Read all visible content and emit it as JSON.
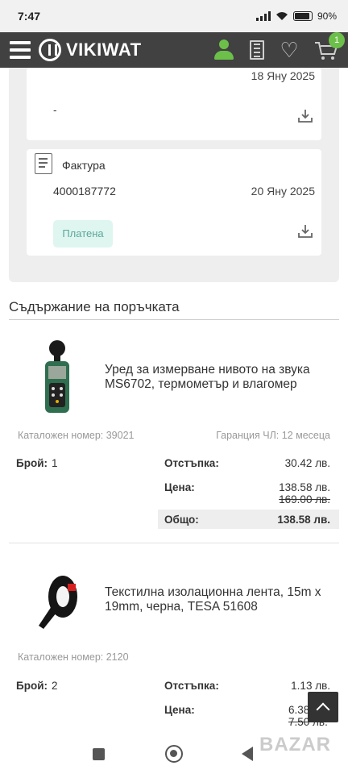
{
  "status_bar": {
    "time": "7:47",
    "battery": "90"
  },
  "header": {
    "logo_text": "VIKIWAT",
    "cart_count": "1"
  },
  "documents": [
    {
      "date": "18 Яну 2025",
      "number": "-"
    },
    {
      "title": "Фактура",
      "number": "4000187772",
      "date": "20 Яну 2025",
      "status": "Платена"
    }
  ],
  "section_title": "Съдържание на поръчката",
  "items": [
    {
      "title": "Уред за измерване нивото на звука MS6702, термометър и влагомер",
      "catalog": "Каталожен номер: 39021",
      "warranty": "Гаранция ЧЛ: 12 месеца",
      "qty_label": "Брой:",
      "qty": "1",
      "discount_label": "Отстъпка:",
      "discount": "30.42 лв.",
      "price_label": "Цена:",
      "price": "138.58 лв.",
      "old_price": "169.00 лв.",
      "total_label": "Общо:",
      "total": "138.58 лв."
    },
    {
      "title": "Текстилна изолационна лента, 15m x 19mm, черна, TESA 51608",
      "catalog": "Каталожен номер: 2120",
      "qty_label": "Брой:",
      "qty": "2",
      "discount_label": "Отстъпка:",
      "discount": "1.13 лв.",
      "price_label": "Цена:",
      "price": "6.38",
      "old_price": "7.50 лв."
    }
  ],
  "watermark": "BAZAR"
}
